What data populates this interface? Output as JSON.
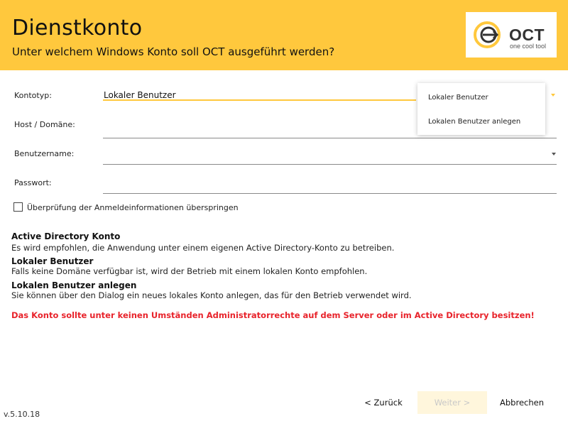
{
  "header": {
    "title": "Dienstkonto",
    "subtitle": "Unter welchem Windows Konto soll OCT ausgeführt werden?",
    "logo_text": "OCT",
    "logo_tagline": "one cool tool"
  },
  "form": {
    "account_type": {
      "label": "Kontotyp:",
      "value": "Lokaler Benutzer"
    },
    "host_domain": {
      "label": "Host / Domäne:",
      "value": ""
    },
    "username": {
      "label": "Benutzername:",
      "value": ""
    },
    "password": {
      "label": "Passwort:",
      "value": ""
    }
  },
  "dropdown": {
    "options": [
      "Lokaler Benutzer",
      "Lokalen Benutzer anlegen"
    ]
  },
  "checkbox": {
    "label": "Überprüfung der Anmeldeinformationen überspringen",
    "checked": false
  },
  "info": [
    {
      "title": "Active Directory Konto",
      "text": "Es wird empfohlen, die Anwendung unter einem eigenen Active Directory-Konto zu betreiben."
    },
    {
      "title": "Lokaler Benutzer",
      "text": "Falls keine Domäne verfügbar ist, wird der Betrieb mit einem lokalen Konto empfohlen."
    },
    {
      "title": "Lokalen Benutzer anlegen",
      "text": "Sie können über den Dialog ein neues lokales Konto anlegen, das für den Betrieb verwendet wird."
    }
  ],
  "warning": "Das Konto sollte unter keinen Umständen Administratorrechte auf dem Server oder im Active Directory besitzen!",
  "buttons": {
    "back": "< Zurück",
    "next": "Weiter >",
    "cancel": "Abbrechen"
  },
  "version": "v.5.10.18",
  "colors": {
    "accent": "#ffc83d",
    "warning": "#e8232b"
  }
}
